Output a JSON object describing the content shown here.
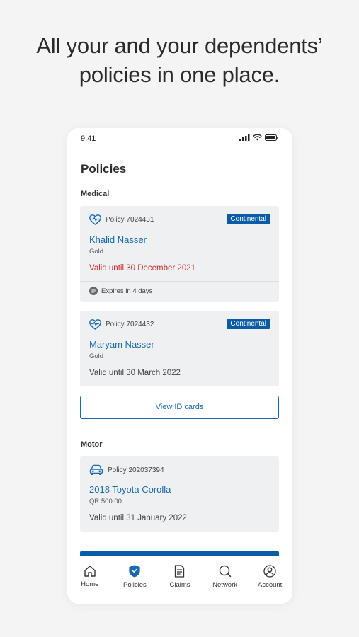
{
  "headline": [
    "All your and your dependents’",
    "policies in one place."
  ],
  "status_bar": {
    "time": "9:41"
  },
  "page_title": "Policies",
  "sections": {
    "medical_label": "Medical",
    "motor_label": "Motor"
  },
  "medical_policies": [
    {
      "policy_number": "Policy 7024431",
      "badge": "Continental",
      "name": "Khalid Nasser",
      "tier": "Gold",
      "valid": "Valid until 30 December 2021",
      "expires_note": "Expires in 4 days"
    },
    {
      "policy_number": "Policy 7024432",
      "badge": "Continental",
      "name": "Maryam Nasser",
      "tier": "Gold",
      "valid": "Valid until 30 March 2022"
    }
  ],
  "view_id_cards_label": "View ID cards",
  "motor_policies": [
    {
      "policy_number": "Policy 202037394",
      "name": "2018 Toyota Corolla",
      "amount": "QR 500.00",
      "valid": "Valid until 31 January 2022"
    }
  ],
  "tabs": [
    {
      "label": "Home",
      "icon": "home-icon",
      "active": false
    },
    {
      "label": "Policies",
      "icon": "shield-icon",
      "active": true
    },
    {
      "label": "Claims",
      "icon": "document-icon",
      "active": false
    },
    {
      "label": "Network",
      "icon": "search-icon",
      "active": false
    },
    {
      "label": "Account",
      "icon": "account-icon",
      "active": false
    }
  ],
  "colors": {
    "brand_blue": "#0a5ca8",
    "link_blue": "#1769b5",
    "warning_red": "#d52b2b"
  }
}
